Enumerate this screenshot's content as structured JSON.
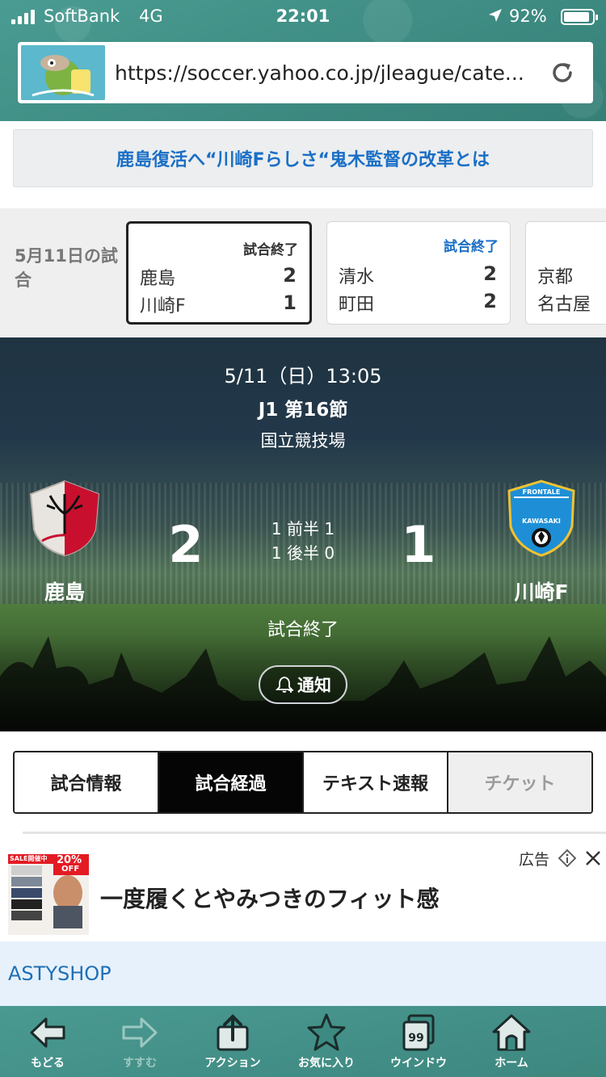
{
  "status_bar": {
    "carrier": "SoftBank",
    "network": "4G",
    "time": "22:01",
    "battery": "92%",
    "battery_level": 0.92
  },
  "browser": {
    "url": "https://soccer.yahoo.co.jp/jleague/cate..."
  },
  "headline": {
    "text": "鹿島復活へ“川崎Fらしさ“鬼木監督の改革とは"
  },
  "matches_strip": {
    "label": "5月11日の試合",
    "cards": [
      {
        "status": "試合終了",
        "home": "鹿島",
        "home_score": "2",
        "away": "川崎F",
        "away_score": "1"
      },
      {
        "status": "試合終了",
        "home": "清水",
        "home_score": "2",
        "away": "町田",
        "away_score": "2"
      },
      {
        "status": "",
        "home": "京都",
        "home_score": "",
        "away": "名古屋",
        "away_score": ""
      }
    ]
  },
  "match": {
    "date": "5/11（日）13:05",
    "round": "J1 第16節",
    "venue": "国立競技場",
    "home_team": "鹿島",
    "away_team": "川崎F",
    "home_score": "2",
    "away_score": "1",
    "first_half": "1 前半 1",
    "second_half": "1 後半 0",
    "status": "試合終了",
    "notify_label": "通知",
    "away_logo_text": "FRONTALE",
    "away_logo_text2": "KAWASAKI"
  },
  "tabs": [
    {
      "label": "試合情報"
    },
    {
      "label": "試合経過"
    },
    {
      "label": "テキスト速報"
    },
    {
      "label": "チケット"
    }
  ],
  "ad": {
    "badge": "SALE開催中",
    "discount": "20%",
    "discount_suffix": "OFF",
    "headline": "一度履くとやみつきのフィット感",
    "label": "広告",
    "brand": "ASTYSHOP"
  },
  "toolbar": {
    "back": "もどる",
    "forward": "すすむ",
    "action": "アクション",
    "favorites": "お気に入り",
    "window": "ウインドウ",
    "window_count": "99",
    "home": "ホーム"
  },
  "colors": {
    "chrome": "#3f8f86",
    "link_blue": "#1a6fc6",
    "home_team": "#c8102e",
    "away_team": "#1e8fd6"
  }
}
